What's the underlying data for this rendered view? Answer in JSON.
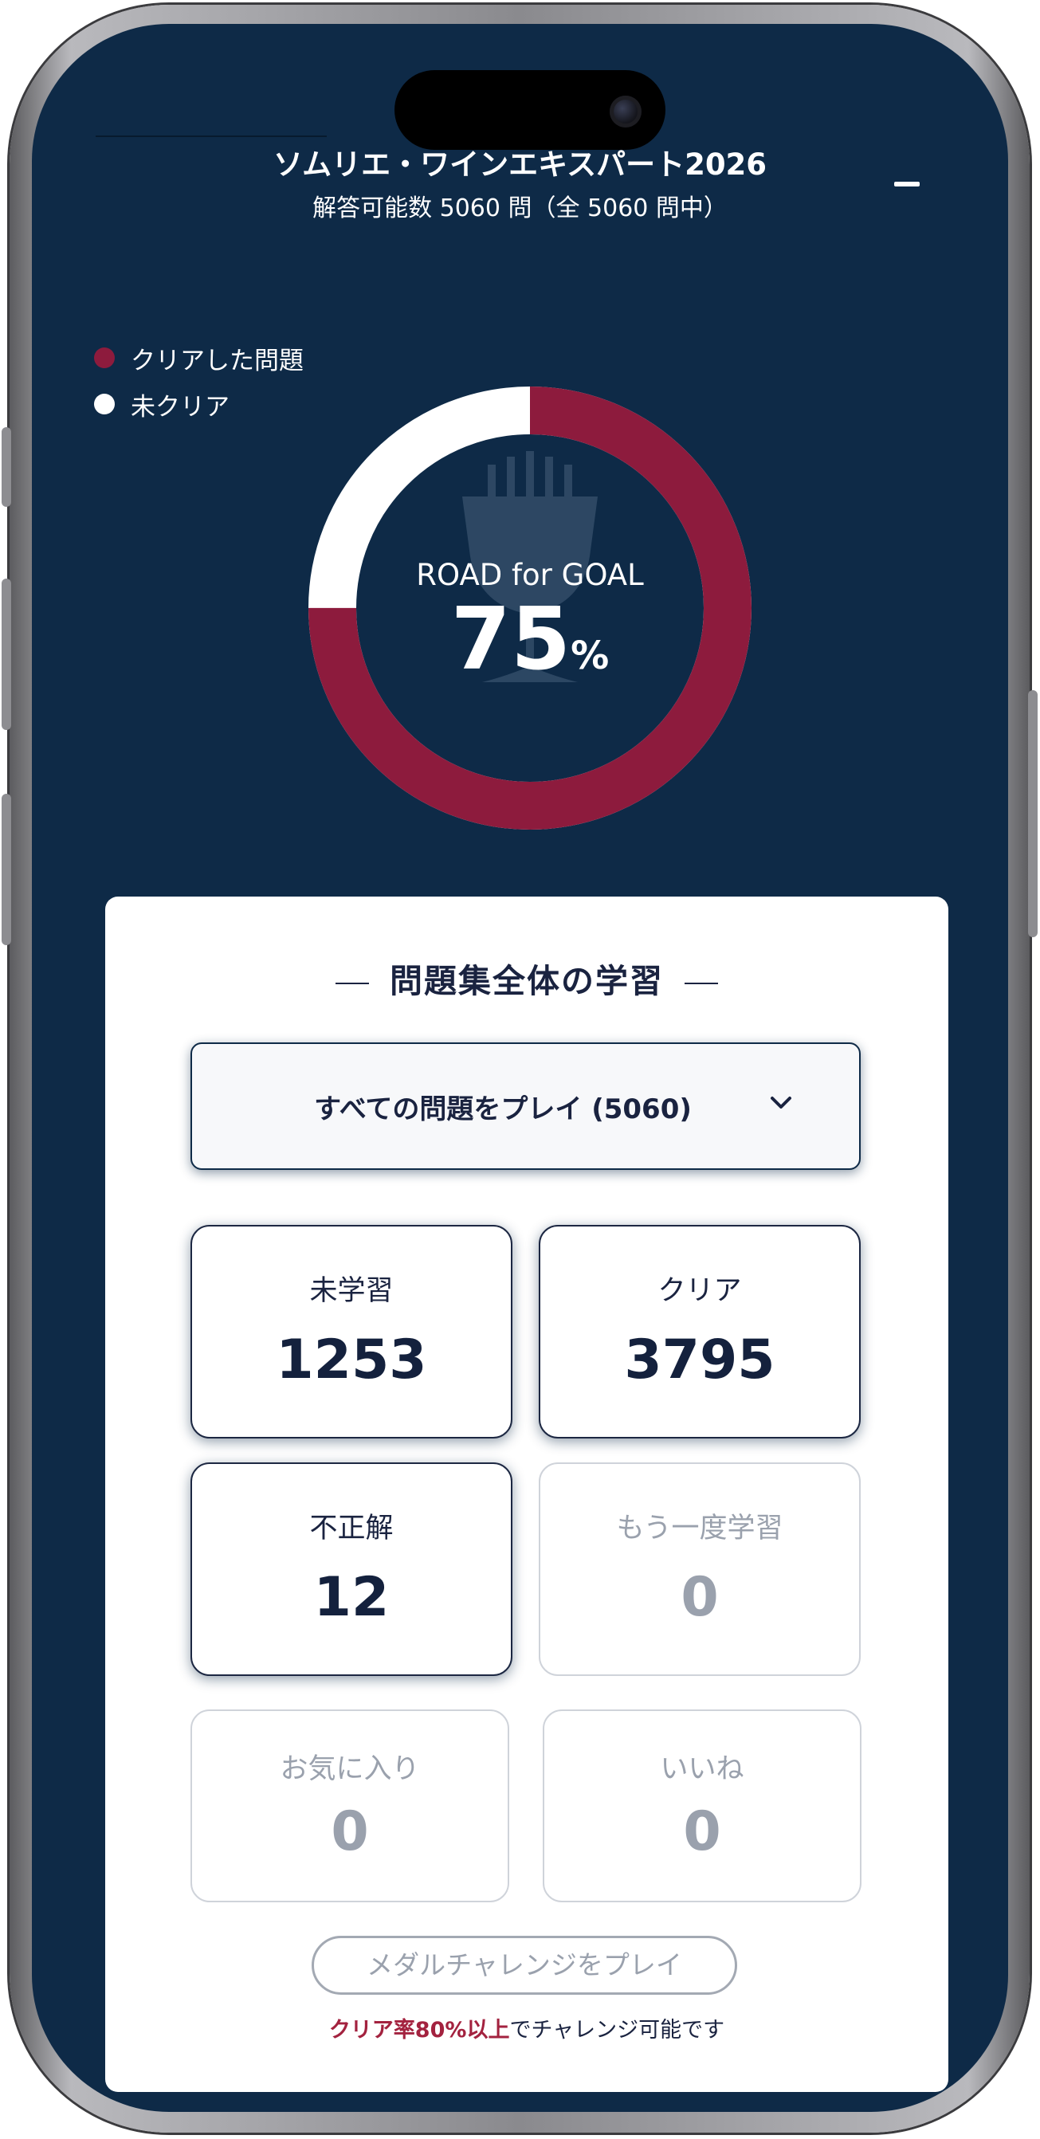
{
  "header": {
    "title": "ソムリエ・ワインエキスパート2026",
    "subtitle": "解答可能数 5060 問（全 5060 問中）"
  },
  "legend": [
    {
      "label": "クリアした問題",
      "color": "#8d1b3d"
    },
    {
      "label": "未クリア",
      "color": "#ffffff"
    }
  ],
  "progress": {
    "label": "ROAD for GOAL",
    "value": "75",
    "unit": "%",
    "fraction": 0.75,
    "cleared_color": "#8d1b3d",
    "remaining_color": "#ffffff"
  },
  "study": {
    "section_title": "問題集全体の学習",
    "select_label": "すべての問題をプレイ (5060)",
    "tiles": [
      {
        "label": "未学習",
        "value": "1253",
        "active": true
      },
      {
        "label": "クリア",
        "value": "3795",
        "active": true
      },
      {
        "label": "不正解",
        "value": "12",
        "active": true
      },
      {
        "label": "もう一度学習",
        "value": "0",
        "active": false
      },
      {
        "label": "お気に入り",
        "value": "0",
        "active": false
      },
      {
        "label": "いいね",
        "value": "0",
        "active": false
      }
    ],
    "medal_button": "メダルチャレンジをプレイ",
    "challenge_note_highlight": "クリア率80%以上",
    "challenge_note_rest": "でチャレンジ可能です"
  },
  "colors": {
    "background": "#0e2a47",
    "accent": "#8d1b3d"
  },
  "icons": {
    "menu": "minus-icon",
    "select_arrow": "chevron-down-icon",
    "donut_center": "wine-glass-icon"
  }
}
